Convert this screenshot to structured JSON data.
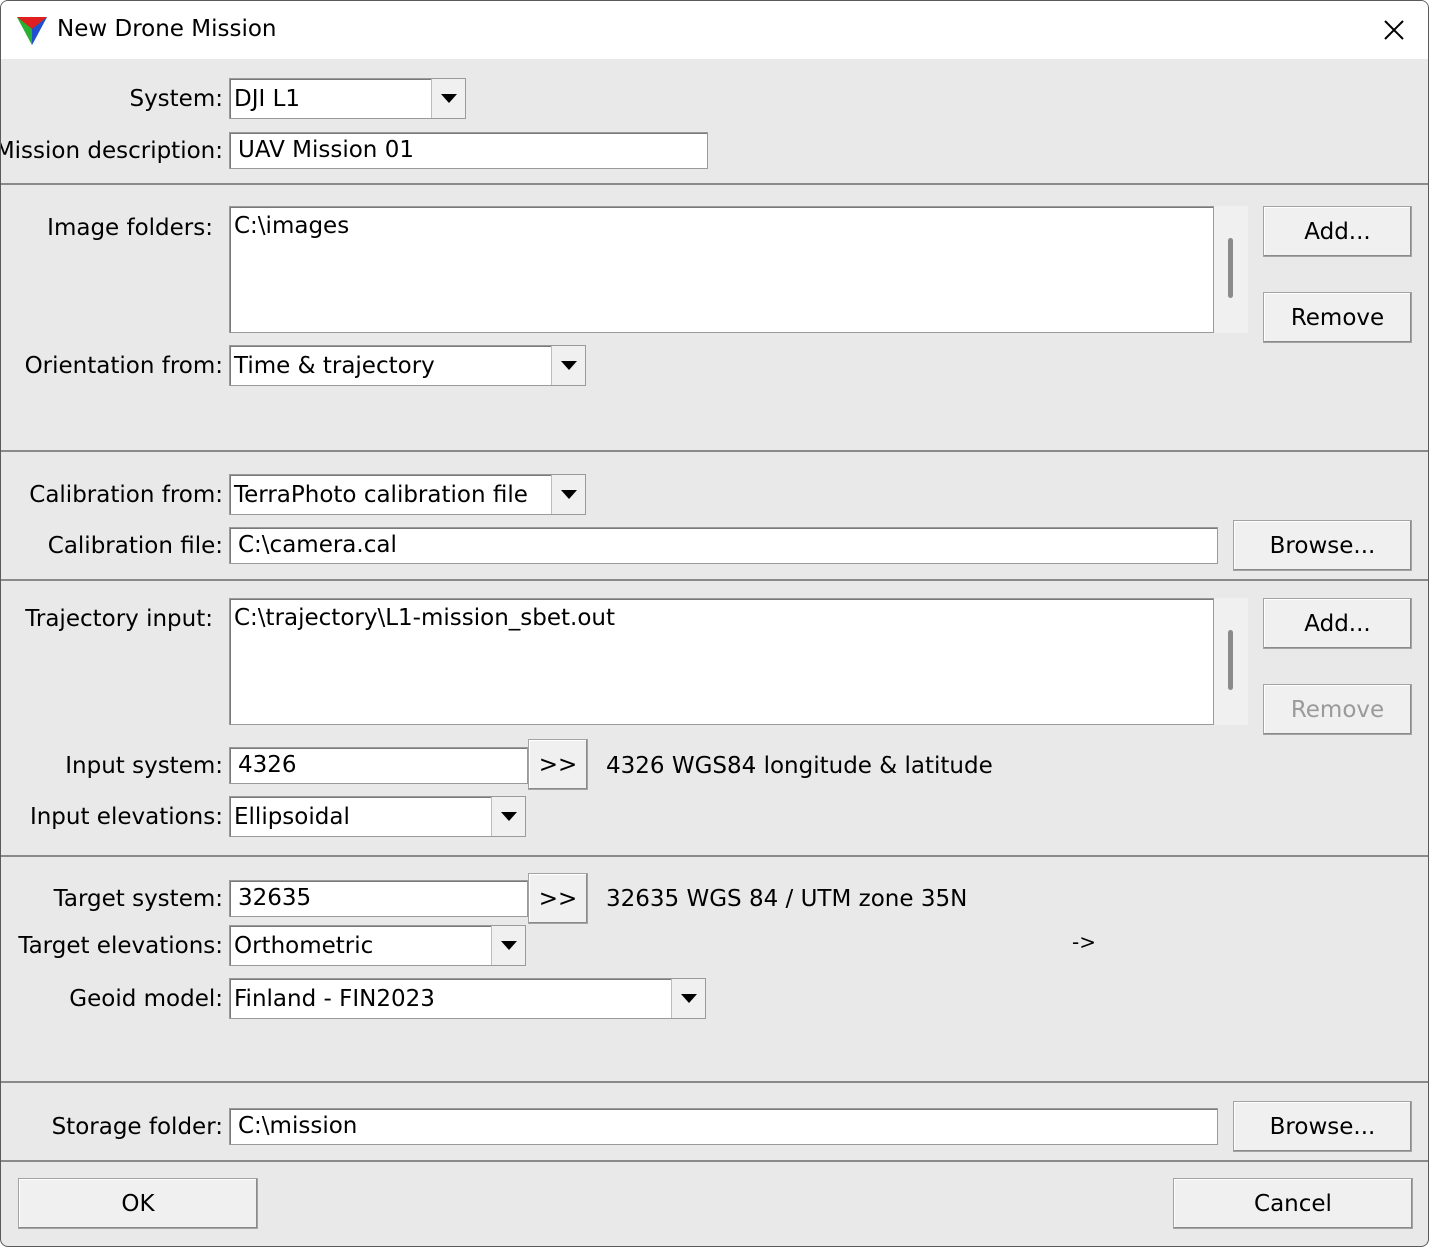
{
  "window": {
    "title": "New Drone Mission",
    "close_icon": "close-icon",
    "app_icon": "terrasolid-triangle-icon"
  },
  "mission": {
    "system_label": "System:",
    "system_value": "DJI L1",
    "description_label": "Mission description:",
    "description_value": "UAV Mission 01"
  },
  "images": {
    "folders_label": "Image folders:",
    "folders": [
      "C:\\images"
    ],
    "add_label": "Add...",
    "remove_label": "Remove",
    "orientation_label": "Orientation from:",
    "orientation_value": "Time & trajectory"
  },
  "calibration": {
    "from_label": "Calibration from:",
    "from_value": "TerraPhoto calibration file",
    "file_label": "Calibration file:",
    "file_value": "C:\\camera.cal",
    "browse_label": "Browse..."
  },
  "trajectory": {
    "input_label": "Trajectory input:",
    "files": [
      "C:\\trajectory\\L1-mission_sbet.out"
    ],
    "add_label": "Add...",
    "remove_label": "Remove",
    "remove_disabled": true,
    "input_system_label": "Input system:",
    "input_system_value": "4326",
    "input_system_button": ">>",
    "input_system_desc": "4326 WGS84 longitude & latitude",
    "input_elevations_label": "Input elevations:",
    "input_elevations_value": "Ellipsoidal"
  },
  "target": {
    "system_label": "Target system:",
    "system_value": "32635",
    "system_button": ">>",
    "system_desc": "32635 WGS 84 / UTM zone 35N",
    "elevations_label": "Target elevations:",
    "elevations_value": "Orthometric",
    "elevations_note": "->",
    "geoid_label": "Geoid model:",
    "geoid_value": "Finland - FIN2023"
  },
  "storage": {
    "folder_label": "Storage folder:",
    "folder_value": "C:\\mission",
    "browse_label": "Browse..."
  },
  "footer": {
    "ok_label": "OK",
    "cancel_label": "Cancel"
  }
}
